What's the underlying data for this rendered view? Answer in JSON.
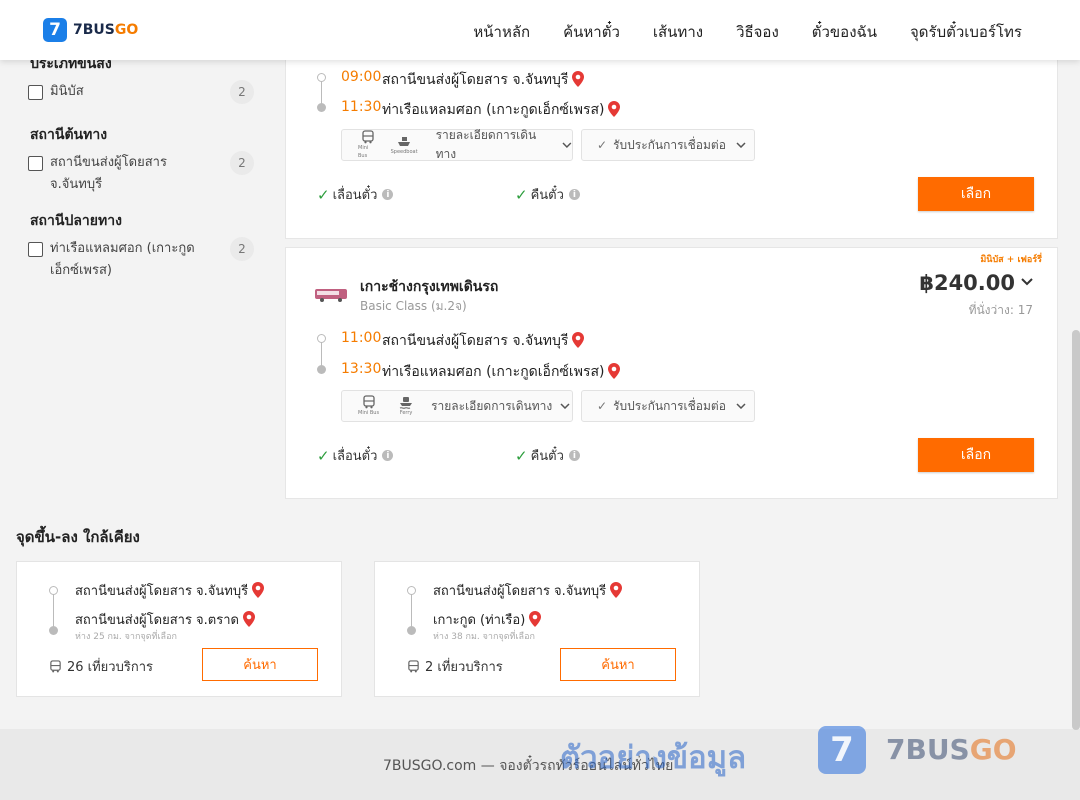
{
  "header": {
    "logo_mark": "7",
    "logo_text_a": "7BUS",
    "logo_text_b": "GO",
    "nav": [
      "หน้าหลัก",
      "ค้นหาตั๋ว",
      "เส้นทาง",
      "วิธีจอง",
      "ตั๋วของฉัน",
      "จุดรับตั๋วเบอร์โทร"
    ]
  },
  "sidebar": {
    "vehicle_type": {
      "title": "ประเภทขนส่ง",
      "options": [
        {
          "label": "มินิบัส",
          "count": "2"
        }
      ]
    },
    "origin": {
      "title": "สถานีต้นทาง",
      "options": [
        {
          "label": "สถานีขนส่งผู้โดยสาร จ.จันทบุรี",
          "count": "2"
        }
      ]
    },
    "destination": {
      "title": "สถานีปลายทาง",
      "options": [
        {
          "label": "ท่าเรือแหลมศอก (เกาะกูดเอ็กซ์เพรส)",
          "count": "2"
        }
      ]
    }
  },
  "results": [
    {
      "depart_time": "09:00",
      "depart_station": "สถานีขนส่งผู้โดยสาร จ.จันทบุรี",
      "arrive_time": "11:30",
      "arrive_station": "ท่าเรือแหลมศอก (เกาะกูดเอ็กซ์เพรส)",
      "vehicle_1": "Mini Bus",
      "vehicle_2": "Speedboat",
      "details_label": "รายละเอียดการเดินทาง",
      "guarantee_label": "รับประกันการเชื่อมต่อ",
      "reschedule_label": "เลื่อนตั๋ว",
      "refund_label": "คืนตั๋ว",
      "select_label": "เลือก"
    },
    {
      "badge": "มินิบัส + เฟอร์รี่",
      "operator": "เกาะช้างกรุงเทพเดินรถ",
      "bus_class": "Basic Class (ม.2จ)",
      "price": "฿240.00",
      "seats": "ที่นั่งว่าง: 17",
      "depart_time": "11:00",
      "depart_station": "สถานีขนส่งผู้โดยสาร จ.จันทบุรี",
      "arrive_time": "13:30",
      "arrive_station": "ท่าเรือแหลมศอก (เกาะกูดเอ็กซ์เพรส)",
      "vehicle_1": "Mini Bus",
      "vehicle_2": "Ferry",
      "details_label": "รายละเอียดการเดินทาง",
      "guarantee_label": "รับประกันการเชื่อมต่อ",
      "reschedule_label": "เลื่อนตั๋ว",
      "refund_label": "คืนตั๋ว",
      "select_label": "เลือก"
    }
  ],
  "nearby": {
    "title": "จุดขึ้น-ลง ใกล้เคียง",
    "cards": [
      {
        "from": "สถานีขนส่งผู้โดยสาร จ.จันทบุรี",
        "to": "สถานีขนส่งผู้โดยสาร จ.ตราด",
        "distance": "ห่าง 25 กม. จากจุดที่เลือก",
        "trips": "26 เที่ยวบริการ",
        "button": "ค้นหา"
      },
      {
        "from": "สถานีขนส่งผู้โดยสาร จ.จันทบุรี",
        "to": "เกาะกูด (ท่าเรือ)",
        "distance": "ห่าง 38 กม. จากจุดที่เลือก",
        "trips": "2 เที่ยวบริการ",
        "button": "ค้นหา"
      }
    ]
  },
  "footer": {
    "text": "7BUSGO.com — จองตั๋วรถทัวร์ออนไลน์ทั่วไทย",
    "watermark": "ตัวอย่างข้อมูล",
    "wm_mark": "7",
    "wm_brand_a": "7BUS",
    "wm_brand_b": "GO"
  },
  "colors": {
    "accent": "#ff6b00",
    "time": "#f57c00",
    "pin": "#e53935",
    "check": "#2e9e3e",
    "brand_blue": "#1b7fe8"
  }
}
